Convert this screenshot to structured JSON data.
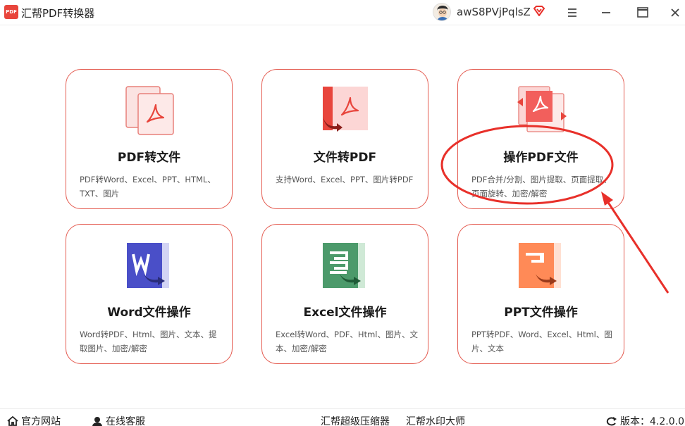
{
  "app": {
    "logo_text": "PDF",
    "title": "汇帮PDF转换器",
    "username": "awS8PVjPqlsZ"
  },
  "cards": [
    {
      "title": "PDF转文件",
      "desc": "PDF转Word、Excel、PPT、HTML、TXT、图片",
      "icon": "pdf-files-icon"
    },
    {
      "title": "文件转PDF",
      "desc": "支持Word、Excel、PPT、图片转PDF",
      "icon": "file-to-pdf-icon"
    },
    {
      "title": "操作PDF文件",
      "desc": "PDF合并/分割、图片提取、页面提取、页面旋转、加密/解密",
      "icon": "pdf-operate-icon"
    },
    {
      "title": "Word文件操作",
      "desc": "Word转PDF、Html、图片、文本、提取图片、加密/解密",
      "icon": "word-icon"
    },
    {
      "title": "Excel文件操作",
      "desc": "Excel转Word、PDF、Html、图片、文本、加密/解密",
      "icon": "excel-icon"
    },
    {
      "title": "PPT文件操作",
      "desc": "PPT转PDF、Word、Excel、Html、图片、文本",
      "icon": "ppt-icon"
    }
  ],
  "footer": {
    "website": "官方网站",
    "support": "在线客服",
    "compressor": "汇帮超级压缩器",
    "watermark": "汇帮水印大师",
    "version": "版本：4.2.0.0"
  },
  "colors": {
    "accent": "#e45b50",
    "pdf_red": "#f26b6b",
    "word_blue": "#4a4fc8",
    "excel_green": "#4c9a6b",
    "ppt_orange": "#ff8a57",
    "annotation_red": "#e8302a"
  }
}
